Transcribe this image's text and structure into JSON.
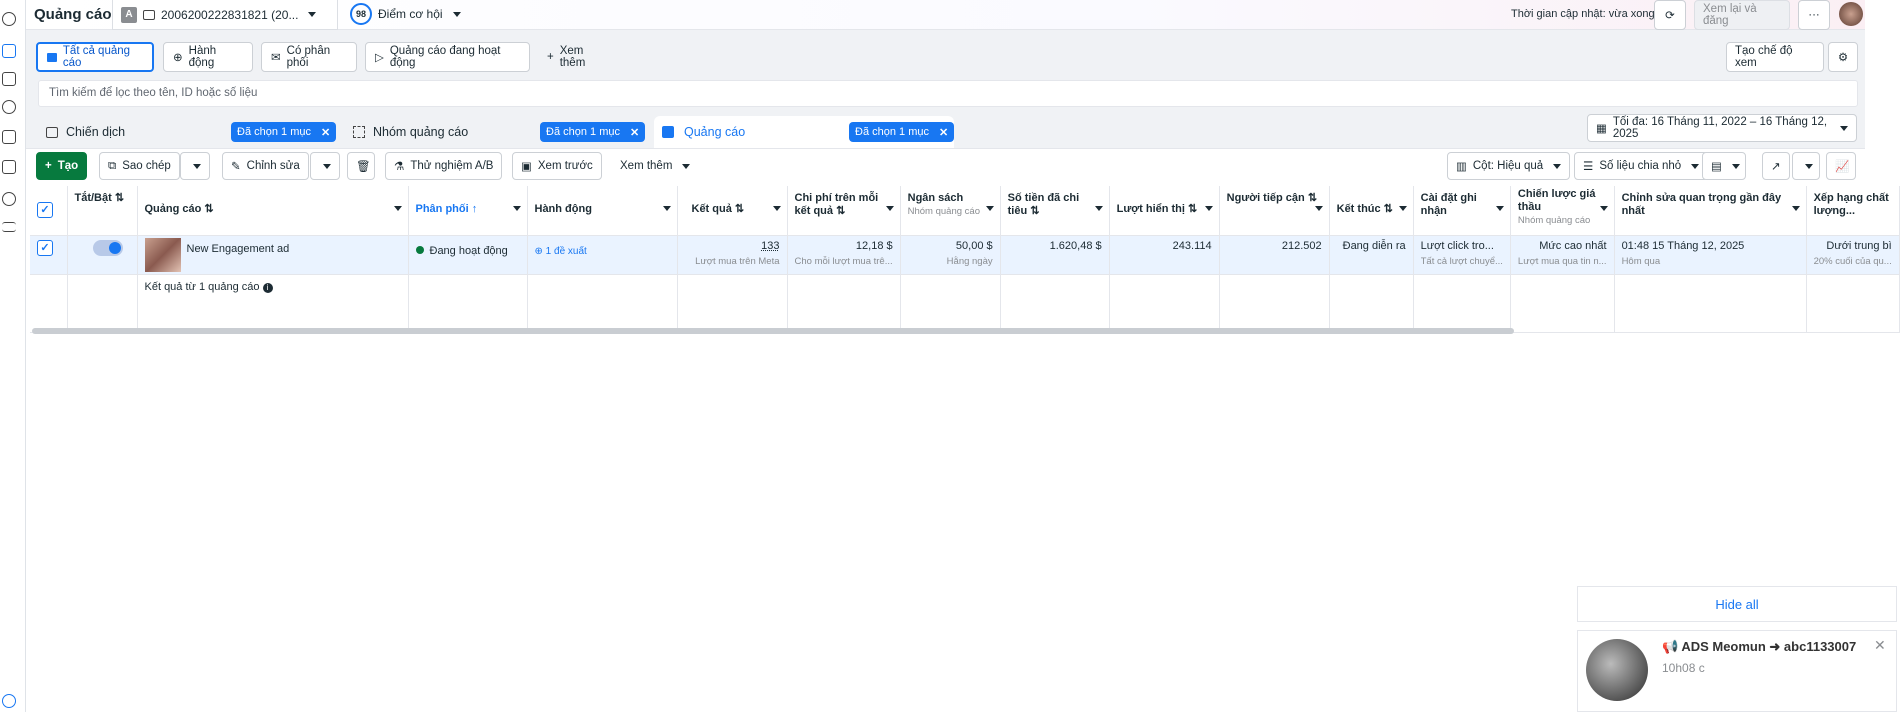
{
  "header": {
    "title": "Quảng cáo",
    "account_badge": "A",
    "account_id": "2006200222831821 (20...",
    "score": "98",
    "score_label": "Điểm cơ hội",
    "update_status": "Thời gian cập nhật: vừa xong",
    "review_publish": "Xem lại và đăng"
  },
  "filter_tabs": [
    {
      "label": "Tất cả quảng cáo"
    },
    {
      "label": "Hành động"
    },
    {
      "label": "Có phân phối"
    },
    {
      "label": "Quảng cáo đang hoạt động"
    },
    {
      "label": "Xem thêm"
    }
  ],
  "create_view": "Tạo chế độ xem",
  "search": {
    "placeholder": "Tìm kiếm để lọc theo tên, ID hoặc số liệu"
  },
  "levels": [
    {
      "label": "Chiến dịch",
      "chip": "Đã chọn 1 mục"
    },
    {
      "label": "Nhóm quảng cáo",
      "chip": "Đã chọn 1 mục"
    },
    {
      "label": "Quảng cáo",
      "chip": "Đã chọn 1 mục"
    }
  ],
  "date_range": "Tối đa: 16 Tháng 11, 2022 – 16 Tháng 12, 2025",
  "toolbar": {
    "create": "Tạo",
    "duplicate": "Sao chép",
    "edit": "Chỉnh sửa",
    "ab_test": "Thử nghiệm A/B",
    "preview": "Xem trước",
    "more": "Xem thêm",
    "columns": "Cột: Hiệu quả",
    "breakdown": "Số liệu chia nhỏ"
  },
  "table": {
    "headers": {
      "toggle": "Tắt/Bật",
      "ad": "Quảng cáo",
      "delivery": "Phân phối",
      "actions": "Hành động",
      "results": "Kết quả",
      "cpr": "Chi phí trên mỗi kết quả",
      "budget": "Ngân sách",
      "budget_sub": "Nhóm quảng cáo",
      "spent": "Số tiền đã chi tiêu",
      "impressions": "Lượt hiển thị",
      "reach": "Người tiếp cận",
      "ends": "Kết thúc",
      "attribution": "Cài đặt ghi nhận",
      "bid": "Chiến lược giá thầu",
      "bid_sub": "Nhóm quảng cáo",
      "last_edit": "Chỉnh sửa quan trọng gần đây nhất",
      "quality": "Xếp hạng chất lượng..."
    },
    "row": {
      "name": "New Engagement ad",
      "delivery": "Đang hoạt động",
      "actions": "1 đề xuất",
      "results": "133",
      "results_sub": "Lượt mua trên Meta",
      "cpr": "12,18 $",
      "cpr_sub": "Cho mỗi lượt mua trê...",
      "budget": "50,00 $",
      "budget_sub": "Hằng ngày",
      "spent": "1.620,48 $",
      "impressions": "243.114",
      "reach": "212.502",
      "ends": "Đang diễn ra",
      "attribution": "Lượt click tro...",
      "attribution_sub": "Tất cả lượt chuyể...",
      "bid": "Mức cao nhất",
      "bid_sub": "Lượt mua qua tin n...",
      "last_edit": "01:48 15 Tháng 12, 2025",
      "last_edit_sub": "Hôm qua",
      "quality": "Dưới trung bì",
      "quality_sub": "20% cuối của qu..."
    },
    "summary": "Kết quả từ 1 quảng cáo"
  },
  "notifications": {
    "hide_all": "Hide all",
    "title": "📢 ADS Meomun ➜ abc1133007",
    "time": "10h08 c"
  }
}
